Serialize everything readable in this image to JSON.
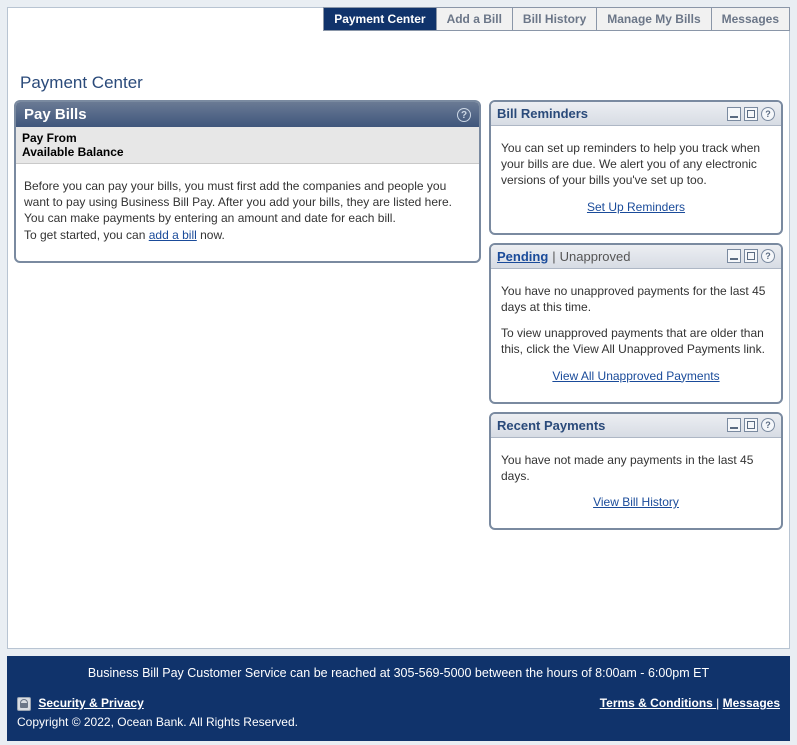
{
  "tabs": {
    "payment_center": "Payment Center",
    "add_bill": "Add a Bill",
    "bill_history": "Bill History",
    "manage_bills": "Manage My Bills",
    "messages": "Messages"
  },
  "page_title": "Payment Center",
  "pay_bills": {
    "header": "Pay Bills",
    "pay_from_label": "Pay From",
    "available_balance_label": "Available Balance",
    "intro_before": "Before you can pay your bills, you must first add the companies and people you want to pay using Business Bill Pay. After you add your bills, they are listed here. You can make payments by entering an amount and date for each bill.",
    "get_started_prefix": "To get started, you can ",
    "add_bill_link": "add a bill",
    "get_started_suffix": " now."
  },
  "reminders": {
    "title": "Bill Reminders",
    "body": "You can set up reminders to help you track when your bills are due. We alert you of any electronic versions of your bills you've set up too.",
    "link": "Set Up Reminders"
  },
  "pending": {
    "pending_label": "Pending",
    "separator": "|",
    "unapproved_label": "Unapproved",
    "body1": "You have no unapproved payments for the last 45 days at this time.",
    "body2": "To view unapproved payments that are older than this, click the View All Unapproved Payments link.",
    "link": "View All Unapproved Payments"
  },
  "recent": {
    "title": "Recent Payments",
    "body": "You have not made any payments in the last 45 days.",
    "link": "View Bill History"
  },
  "footer": {
    "customer_service": "Business Bill Pay Customer Service can be reached at 305-569-5000 between the hours of 8:00am - 6:00pm ET",
    "security_privacy": "Security & Privacy",
    "terms": "Terms & Conditions ",
    "sep": "|",
    "messages": "Messages",
    "copyright": "Copyright © 2022, Ocean Bank. All Rights Reserved."
  }
}
